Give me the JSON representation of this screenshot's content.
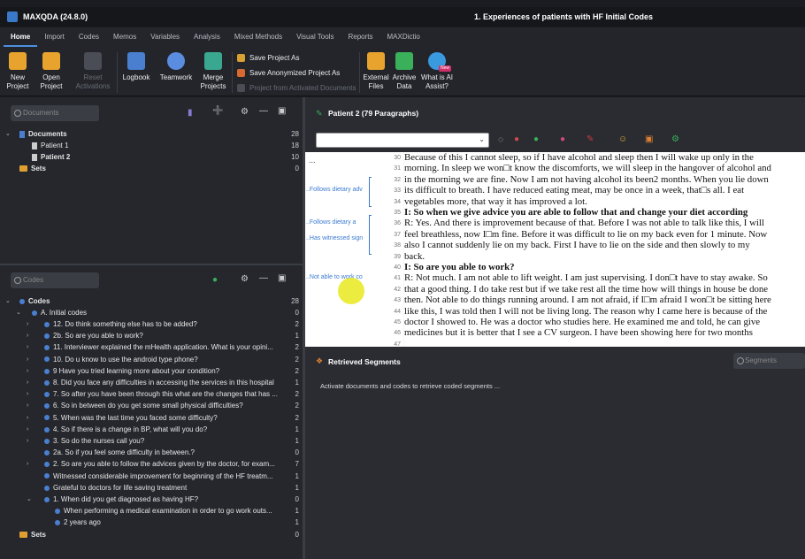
{
  "window": {
    "app_title": "MAXQDA (24.8.0)",
    "doc_title": "1. Experiences of patients with HF Initial Codes"
  },
  "menu": [
    "Home",
    "Import",
    "Codes",
    "Memos",
    "Variables",
    "Analysis",
    "Mixed Methods",
    "Visual Tools",
    "Reports",
    "MAXDictio"
  ],
  "ribbon": {
    "new_project": "New Project",
    "open_project": "Open Project",
    "reset_activations": "Reset Activations",
    "logbook": "Logbook",
    "teamwork": "Teamwork",
    "merge_projects": "Merge Projects",
    "save_as": "Save Project As",
    "save_anon": "Save Anonymized Project As",
    "from_activated": "Project from Activated Documents",
    "external_files": "External Files",
    "archive_data": "Archive Data",
    "ai_assist": "What is AI Assist?",
    "new_badge": "New"
  },
  "documents": {
    "search_placeholder": "Documents",
    "root": {
      "label": "Documents",
      "count": "28"
    },
    "items": [
      {
        "label": "Patient 1",
        "count": "18"
      },
      {
        "label": "Patient 2",
        "count": "10"
      }
    ],
    "sets": {
      "label": "Sets",
      "count": "0"
    }
  },
  "codes": {
    "search_placeholder": "Codes",
    "root": {
      "label": "Codes",
      "count": "28"
    },
    "group": {
      "label": "A. Initial codes",
      "count": "0"
    },
    "items": [
      {
        "label": "12. Do think something else has to be added?",
        "count": "2"
      },
      {
        "label": "2b. So are you able to work?",
        "count": "1"
      },
      {
        "label": "11. Interviewer explained the mHealth application.  What is your opini...",
        "count": "2"
      },
      {
        "label": "10. Do u know to use the android type phone?",
        "count": "2"
      },
      {
        "label": "9 Have you tried learning more about your condition?",
        "count": "2"
      },
      {
        "label": "8. Did you face any difficulties in accessing the services in this hospital",
        "count": "1"
      },
      {
        "label": "7. So after you have been through this what are the changes that has ...",
        "count": "2"
      },
      {
        "label": "6. So in between do you get some small physical difficulties?",
        "count": "2"
      },
      {
        "label": "5.  When was the last time you faced some difficulty?",
        "count": "2"
      },
      {
        "label": "4. So if there is a change in BP, what will you do?",
        "count": "1"
      },
      {
        "label": "3. So do the nurses call you?",
        "count": "1"
      },
      {
        "label": "2a. So if you feel some difficulty in between.?",
        "count": "0"
      },
      {
        "label": "2. So are you able to follow the advices given by the doctor, for exam...",
        "count": "7"
      },
      {
        "label": "Witnessed considerable improvement for beginning of the HF treatm...",
        "count": "1"
      },
      {
        "label": "Grateful to doctors for life saving treatment",
        "count": "1"
      },
      {
        "label": "1. When did you get diagnosed as having HF?",
        "count": "0"
      },
      {
        "label": "When performing a medical examination in order to go work outs...",
        "count": "1"
      },
      {
        "label": "2 years ago",
        "count": "1"
      }
    ],
    "sets": {
      "label": "Sets",
      "count": "0"
    }
  },
  "document_browser": {
    "title": "Patient 2   (79 Paragraphs)",
    "stripes": [
      "...",
      "..Follows dietary adv",
      "..Follows dietary a",
      "..Has witnessed sign",
      "..Not able to work co"
    ],
    "line_numbers": [
      "30",
      "31",
      "32",
      "33",
      "34",
      "35",
      "36",
      "37",
      "38",
      "39",
      "40",
      "41",
      "42",
      "43",
      "44",
      "45",
      "46",
      "47"
    ],
    "lines": [
      "Because of this I cannot sleep, so if I have alcohol and sleep then I will wake up only in the",
      "morning. In sleep we won□t know the discomforts, we will sleep in the hangover of alcohol and",
      "in the morning we are fine. Now I am not having alcohol its been2 months. When you lie down",
      "its difficult to breath. I have reduced eating meat, may be once in a week, that□s all. I eat",
      "vegetables more, that way it has improved a lot.",
      "I: So when we give advice you are able to follow that and change your diet according",
      "R: Yes. And there is improvement because of that. Before I was not able to talk like this, I will",
      "feel breathless, now I□m fine. Before it was difficult to lie on my back even for 1 minute. Now",
      "also I cannot suddenly lie on my back. First I have to lie on the side and then slowly to my",
      "back.",
      "I: So are you able to work?",
      "R: Not much. I am not able to lift weight. I am just supervising. I don□t have to stay awake. So",
      "that a good thing. I do take rest but if we take rest all the time how will things in house be done",
      "then. Not able to do things running around. I am not afraid, if I□m afraid I won□t be sitting here",
      "like this, I was told then I will not be living long. The reason why I came here is because of the",
      "doctor I showed to. He was a doctor who studies here. He examined me and told, he can give",
      "medicines but it is better that I see a CV surgeon. I have been showing here for two months"
    ]
  },
  "retrieved": {
    "title": "Retrieved Segments",
    "search_placeholder": "Segments",
    "message": "Activate documents and codes to retrieve coded segments ..."
  }
}
